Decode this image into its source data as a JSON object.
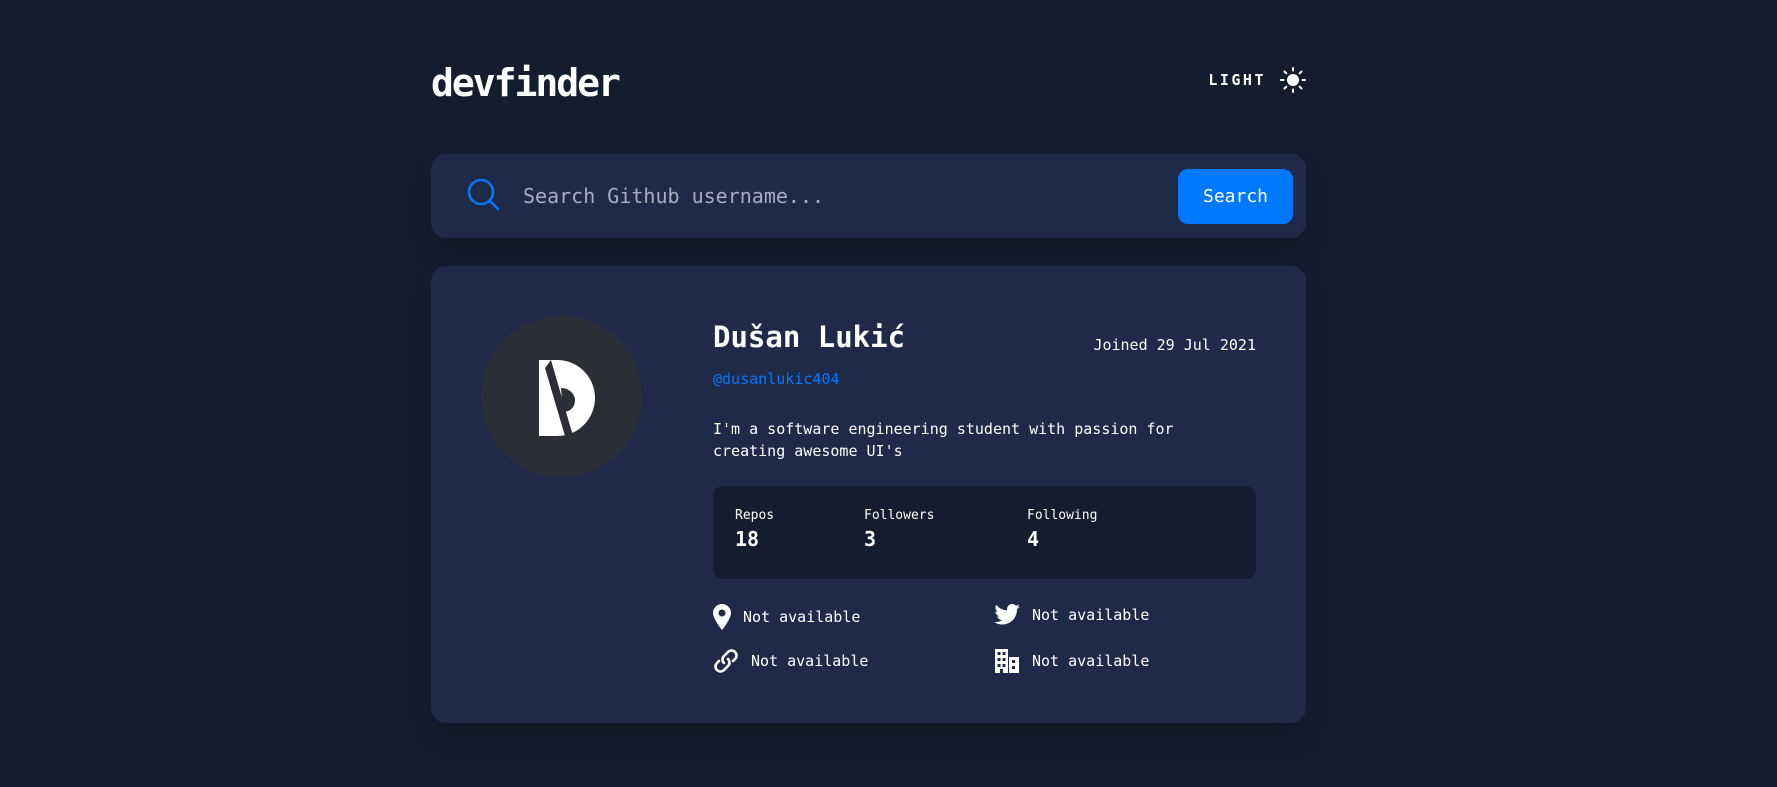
{
  "app": {
    "logo": "devfinder"
  },
  "theme_toggle": {
    "label": "LIGHT",
    "icon": "sun-icon"
  },
  "search": {
    "placeholder": "Search Github username...",
    "value": "",
    "button_label": "Search",
    "icon": "search-icon"
  },
  "profile": {
    "name": "Dušan Lukić",
    "joined": "Joined 29 Jul 2021",
    "handle": "@dusanlukic404",
    "bio_line1": "I'm a software engineering student with passion for",
    "bio_line2": "creating awesome UI's",
    "stats": [
      {
        "label": "Repos",
        "value": "18"
      },
      {
        "label": "Followers",
        "value": "3"
      },
      {
        "label": "Following",
        "value": "4"
      }
    ],
    "links": {
      "location": "Not available",
      "twitter": "Not available",
      "website": "Not available",
      "company": "Not available"
    }
  },
  "colors": {
    "background": "#141D2F",
    "card": "#1E2A47",
    "accent": "#0079FF",
    "text": "#FFFFFF",
    "avatar_bg": "#2B2E36"
  }
}
